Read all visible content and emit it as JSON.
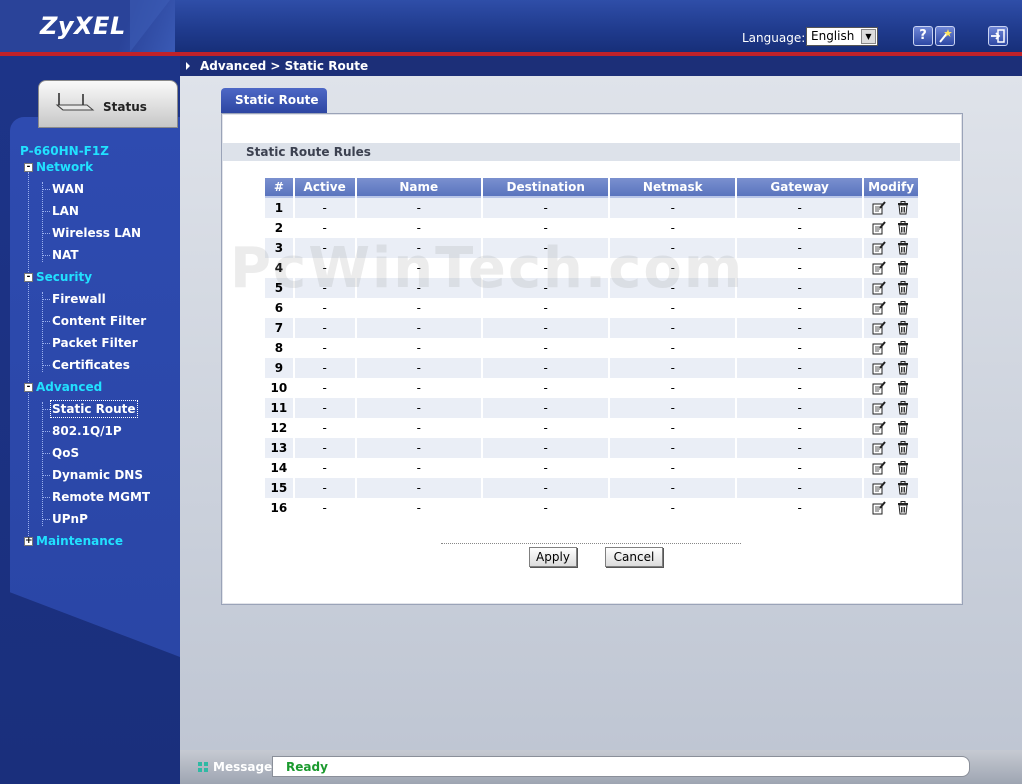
{
  "header": {
    "logo": "ZyXEL",
    "language_label": "Language:",
    "language_value": "English",
    "help_icon": "question-icon",
    "wizard_icon": "wizard-icon",
    "logout_icon": "logout-icon"
  },
  "nav": {
    "status_tab": "Status",
    "model": "P-660HN-F1Z",
    "sections": [
      {
        "label": "Network",
        "expander": "-",
        "items": [
          "WAN",
          "LAN",
          "Wireless LAN",
          "NAT"
        ]
      },
      {
        "label": "Security",
        "expander": "-",
        "items": [
          "Firewall",
          "Content Filter",
          "Packet Filter",
          "Certificates"
        ]
      },
      {
        "label": "Advanced",
        "expander": "-",
        "items": [
          "Static Route",
          "802.1Q/1P",
          "QoS",
          "Dynamic DNS",
          "Remote MGMT",
          "UPnP"
        ]
      },
      {
        "label": "Maintenance",
        "expander": "+",
        "items": []
      }
    ],
    "active_item": "Static Route"
  },
  "breadcrumb": "Advanced > Static Route",
  "tab_label": "Static Route",
  "section_title": "Static Route Rules",
  "table": {
    "headers": [
      "#",
      "Active",
      "Name",
      "Destination",
      "Netmask",
      "Gateway",
      "Modify"
    ],
    "rows": [
      [
        "1",
        "-",
        "-",
        "-",
        "-",
        "-"
      ],
      [
        "2",
        "-",
        "-",
        "-",
        "-",
        "-"
      ],
      [
        "3",
        "-",
        "-",
        "-",
        "-",
        "-"
      ],
      [
        "4",
        "-",
        "-",
        "-",
        "-",
        "-"
      ],
      [
        "5",
        "-",
        "-",
        "-",
        "-",
        "-"
      ],
      [
        "6",
        "-",
        "-",
        "-",
        "-",
        "-"
      ],
      [
        "7",
        "-",
        "-",
        "-",
        "-",
        "-"
      ],
      [
        "8",
        "-",
        "-",
        "-",
        "-",
        "-"
      ],
      [
        "9",
        "-",
        "-",
        "-",
        "-",
        "-"
      ],
      [
        "10",
        "-",
        "-",
        "-",
        "-",
        "-"
      ],
      [
        "11",
        "-",
        "-",
        "-",
        "-",
        "-"
      ],
      [
        "12",
        "-",
        "-",
        "-",
        "-",
        "-"
      ],
      [
        "13",
        "-",
        "-",
        "-",
        "-",
        "-"
      ],
      [
        "14",
        "-",
        "-",
        "-",
        "-",
        "-"
      ],
      [
        "15",
        "-",
        "-",
        "-",
        "-",
        "-"
      ],
      [
        "16",
        "-",
        "-",
        "-",
        "-",
        "-"
      ]
    ],
    "modify_icons": [
      "edit-icon",
      "delete-icon"
    ]
  },
  "buttons": {
    "apply": "Apply",
    "cancel": "Cancel"
  },
  "message": {
    "label": "Message",
    "status": "Ready"
  },
  "watermark": "PcWinTech.com",
  "colors": {
    "brand_blue": "#1f3a8c",
    "accent_red": "#c0222a",
    "menu_cyan": "#21e1ff",
    "status_green": "#1b9a2e"
  }
}
